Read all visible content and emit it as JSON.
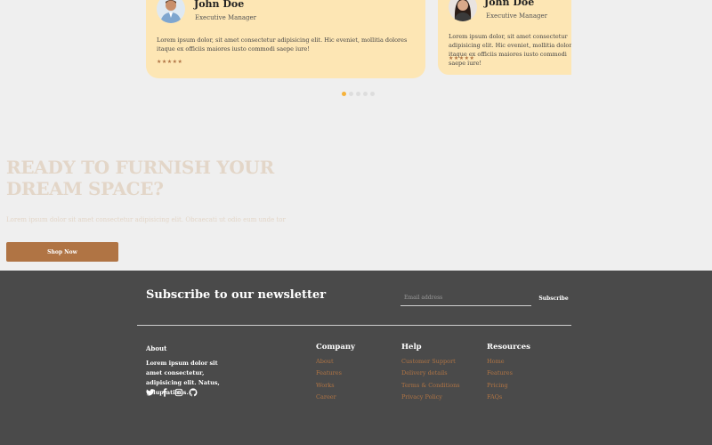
{
  "testimonials": [
    {
      "name": "John Doe",
      "role": "Executive Manager",
      "quote": "Lorem ipsum dolor, sit amet consectetur adipisicing elit. Hic eveniet, mollitia dolores itaque ex officiis maiores iusto commodi saepe iure!",
      "stars": "★★★★★"
    },
    {
      "name": "John Doe",
      "role": "Executive Manager",
      "quote": "Lorem ipsum dolor, sit amet consectetur adipisicing elit. Hic eveniet, mollitia dolores itaque ex officiis maiores iusto commodi saepe iure!",
      "stars": "★★★★★"
    }
  ],
  "carousel": {
    "active_index": 0,
    "count": 5
  },
  "cta": {
    "title": "READY TO FURNISH YOUR DREAM SPACE?",
    "subtitle": "Lorem ipsum dolor sit amet consectetur adipisicing elit. Obcaecati ut odio eum unde tor",
    "button": "Shop Now"
  },
  "footer": {
    "newsletter_title": "Subscribe to our newsletter",
    "email_placeholder": "Email address",
    "subscribe_button": "Subscribe",
    "about_heading": "About",
    "about_text": "Lorem ipsum dolor sit amet consectetur, adipisicing elit. Natus, voluptatibus.",
    "columns": {
      "company": {
        "heading": "Company",
        "links": [
          "About",
          "Features",
          "Works",
          "Career"
        ]
      },
      "help": {
        "heading": "Help",
        "links": [
          "Customer Support",
          "Delivery details",
          "Terms & Conditions",
          "Privacy Policy"
        ]
      },
      "resources": {
        "heading": "Resources",
        "links": [
          "Home",
          "Features",
          "Pricing",
          "FAQs"
        ]
      }
    },
    "socials": [
      "twitter-icon",
      "facebook-icon",
      "instagram-icon",
      "github-icon"
    ]
  },
  "colors": {
    "accent": "#b07444",
    "card": "#fde6b4",
    "footer_bg": "#4a4a4a",
    "dot_active": "#f6b23a"
  }
}
